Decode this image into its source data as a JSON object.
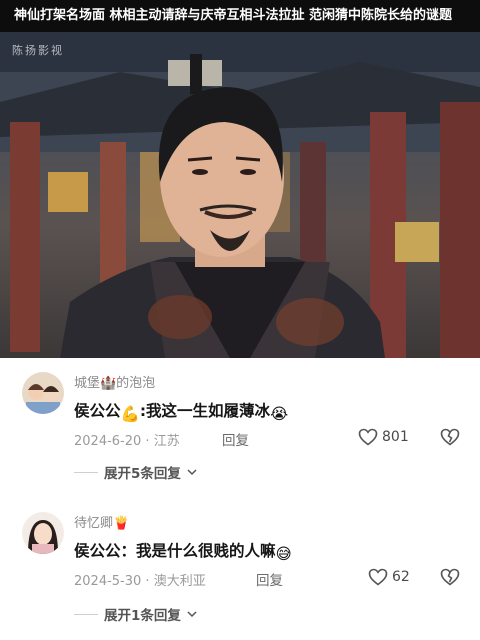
{
  "header": {
    "title": "神仙打架名场面 林相主动请辞与庆帝互相斗法拉扯 范闲猜中陈院长给的谜题"
  },
  "video": {
    "watermark": "陈扬影视"
  },
  "comments": [
    {
      "username": "城堡🏰的泡泡",
      "text_prefix": "侯公公",
      "emoji_a": "💪",
      "text_body": ":我这一生如履薄冰",
      "emoji_b": "😭",
      "date": "2024-6-20",
      "location": "江苏",
      "reply_label": "回复",
      "likes": "801",
      "expand_label": "展开5条回复"
    },
    {
      "username": "待忆卿",
      "username_emoji": "🍟",
      "text": "侯公公：我是什么很贱的人嘛",
      "emoji_b": "😅",
      "date": "2024-5-30",
      "location": "澳大利亚",
      "reply_label": "回复",
      "likes": "62",
      "expand_label": "展开1条回复"
    }
  ]
}
